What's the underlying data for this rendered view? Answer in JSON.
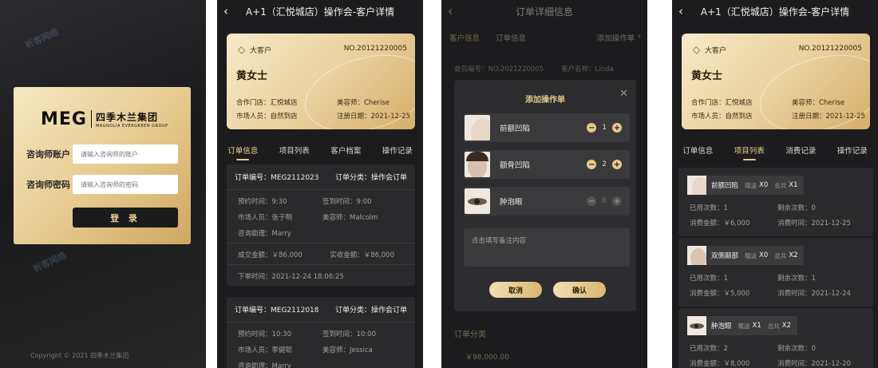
{
  "login": {
    "logo_brand": "MEG",
    "logo_cn": "四季木兰集团",
    "logo_en": "MAGNOLIA EVERGREEN GROUP",
    "account_label": "咨询师账户",
    "account_placeholder": "请输入咨询师的账户",
    "password_label": "咨询师密码",
    "password_placeholder": "请输入咨询师的密码",
    "login_button": "登 录",
    "copyright": "Copyright © 2021   四季木兰集团",
    "watermark": "析客网络"
  },
  "customer": {
    "title": "A+1（汇悦城店）操作会-客户详情",
    "tier": "大客户",
    "number": "NO.20121220005",
    "name": "黄女士",
    "store": "合作门店：汇悦城店",
    "beautician": "美容师：Cherise",
    "marketer": "市场人员：自然到店",
    "register_date": "注册日期：2021-12-25",
    "tabs": [
      "订单信息",
      "项目列表",
      "客户档案",
      "操作记录"
    ]
  },
  "orders": [
    {
      "id": "订单编号：MEG2112023",
      "category": "订单分类：操作会订单",
      "appointment": "预约时间：9:30",
      "signin": "签到时间：9:00",
      "marketer": "市场人员：张子明",
      "beautician": "美容师：Malcolm",
      "assistant": "咨询助理：Marry",
      "deal_amount": "成交金额：￥86,000",
      "received_amount": "实收金额：￥86,000",
      "order_time": "下单时间：2021-12-24 18:06:25"
    },
    {
      "id": "订单编号：MEG2112018",
      "category": "订单分类：操作会订单",
      "appointment": "预约时间：10:30",
      "signin": "签到时间：10:00",
      "marketer": "市场人员：李健聪",
      "beautician": "美容师：Jessica",
      "assistant": "咨询助理：Marry"
    }
  ],
  "order_detail": {
    "title": "订单详细信息",
    "tabs": [
      "客户信息",
      "订单信息"
    ],
    "add_op": "添加操作单",
    "member_no": "会员编号：NO.2021220005",
    "customer_name": "客户名称：Linda",
    "section": "订单分类",
    "amount": "￥98,000.00",
    "modal": {
      "title": "添加操作单",
      "items": [
        {
          "label": "前额凹陷",
          "qty": "1"
        },
        {
          "label": "额骨凹陷",
          "qty": "2"
        },
        {
          "label": "肿泡眼",
          "qty": "0"
        }
      ],
      "note_placeholder": "点击填写备注内容",
      "cancel": "取消",
      "confirm": "确认"
    }
  },
  "projects": {
    "items": [
      {
        "name": "前额凹陷",
        "gift_label": "赠送",
        "gift": "X0",
        "total_label": "总共",
        "total": "X1",
        "used": "已用次数：1",
        "remaining": "剩余次数：0",
        "amount": "消费金额：￥6,000",
        "time": "消费时间：2021-12-25"
      },
      {
        "name": "双侧颞部",
        "gift_label": "赠送",
        "gift": "X0",
        "total_label": "总共",
        "total": "X2",
        "used": "已用次数：1",
        "remaining": "剩余次数：1",
        "amount": "消费金额：￥5,000",
        "time": "消费时间：2021-12-24"
      },
      {
        "name": "肿泡眼",
        "gift_label": "赠送",
        "gift": "X1",
        "total_label": "总共",
        "total": "X2",
        "used": "已用次数：2",
        "remaining": "剩余次数：0",
        "amount": "消费金额：￥8,000",
        "time": "消费时间：2021-12-20"
      }
    ]
  },
  "colors": {
    "gold": "#e6c98e",
    "dark": "#1c1c1e",
    "card": "#2a2a2c"
  }
}
